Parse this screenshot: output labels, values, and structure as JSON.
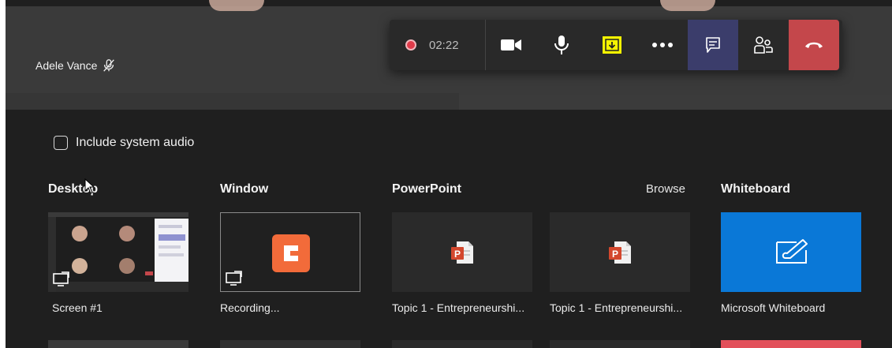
{
  "participant": {
    "name": "Adele Vance"
  },
  "call_toolbar": {
    "recording_time": "02:22",
    "buttons": [
      "recording-indicator",
      "camera-icon",
      "microphone-icon",
      "share-tray-icon",
      "more-options-icon",
      "chat-icon",
      "participants-icon",
      "hang-up-icon"
    ]
  },
  "share_tray": {
    "include_audio_label": "Include system audio",
    "sections": {
      "desktop": "Desktop",
      "window": "Window",
      "powerpoint": "PowerPoint",
      "browse": "Browse",
      "whiteboard": "Whiteboard"
    },
    "items": [
      {
        "label": "Screen #1"
      },
      {
        "label": "Recording..."
      },
      {
        "label": "Topic 1 - Entrepreneurshi..."
      },
      {
        "label": "Topic 1 - Entrepreneurshi..."
      },
      {
        "label": "Microsoft Whiteboard"
      }
    ]
  },
  "colors": {
    "background": "#1f1f1f",
    "whiteboard": "#0a78d7",
    "hangup": "#c4474b",
    "share_highlight": "#f5f400",
    "active_toolbar": "#3b3d6b"
  }
}
